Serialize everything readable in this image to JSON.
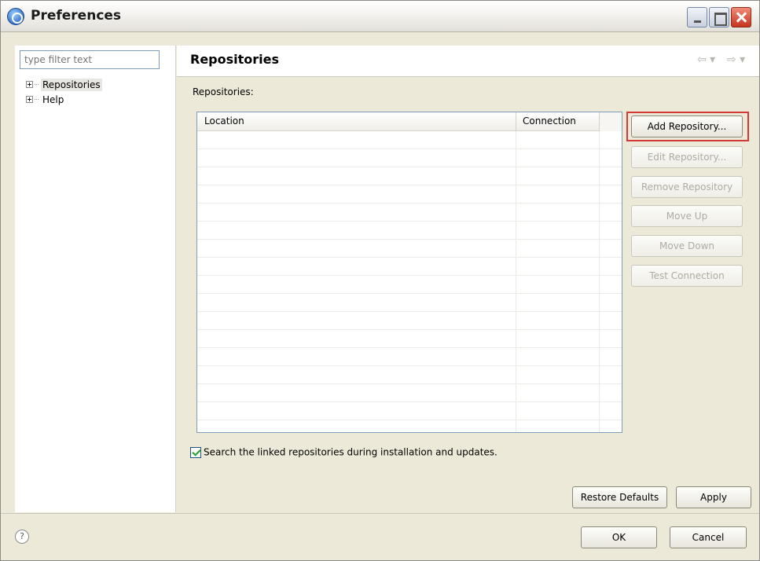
{
  "window": {
    "title": "Preferences"
  },
  "sidebar": {
    "filter_placeholder": "type filter text",
    "items": [
      {
        "label": "Repositories",
        "selected": true
      },
      {
        "label": "Help",
        "selected": false
      }
    ]
  },
  "main": {
    "title": "Repositories",
    "repositories_label": "Repositories:",
    "table": {
      "columns": [
        "Location",
        "Connection"
      ],
      "rows": []
    },
    "buttons": {
      "add": "Add Repository...",
      "edit": "Edit Repository...",
      "remove": "Remove Repository",
      "move_up": "Move Up",
      "move_down": "Move Down",
      "test": "Test Connection"
    },
    "checkbox": {
      "label": "Search the linked repositories during installation and updates.",
      "checked": true
    },
    "restore_defaults": "Restore Defaults",
    "apply": "Apply"
  },
  "footer": {
    "ok": "OK",
    "cancel": "Cancel"
  },
  "icons": {
    "app": "preferences-icon",
    "help": "help-icon",
    "back": "back-arrow-icon",
    "forward": "forward-arrow-icon"
  },
  "colors": {
    "dialog_bg": "#ece9d8",
    "highlight_border": "#d23a3a",
    "checkbox_check": "#21a121"
  }
}
